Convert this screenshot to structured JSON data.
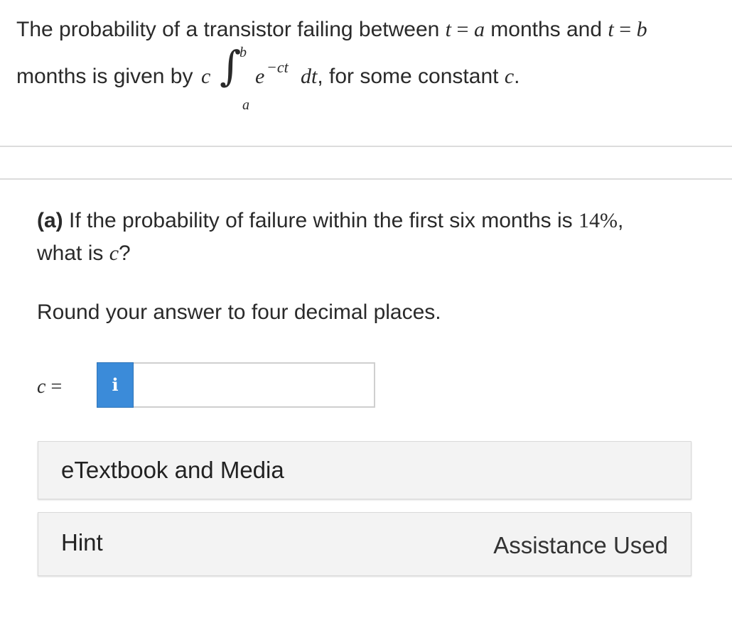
{
  "intro": {
    "line1_text": "The probability of a transistor failing between",
    "line1_var_t1": "t",
    "line1_eq1": " = ",
    "line1_var_a": "a",
    "line1_mid": " months and ",
    "line1_var_t2": "t",
    "line1_eq2": " = ",
    "line1_var_b": "b",
    "line2_start": "months is given by",
    "line2_coef": "c",
    "integral_upper": "b",
    "integral_lower": "a",
    "integrand_base": "e",
    "integrand_exp": "−ct",
    "integrand_dt": "dt",
    "line2_end": ", for some constant",
    "line2_const": "c",
    "line2_period": "."
  },
  "question": {
    "part_label": "(a)",
    "text_start": " If the probability of failure within the first six months is ",
    "percent": "14%",
    "comma": ",",
    "text_line2": "what is ",
    "var_c": "c",
    "qmark": "?"
  },
  "instruction": "Round your answer to four decimal places.",
  "answer": {
    "label_var": "c",
    "label_eq": " = ",
    "info_icon_glyph": "i",
    "input_value": ""
  },
  "panels": {
    "ebook_label": "eTextbook and Media",
    "hint_label": "Hint",
    "assistance_used": "Assistance Used"
  },
  "colors": {
    "info_button": "#3b8bd9",
    "panel_bg": "#f3f3f3"
  }
}
